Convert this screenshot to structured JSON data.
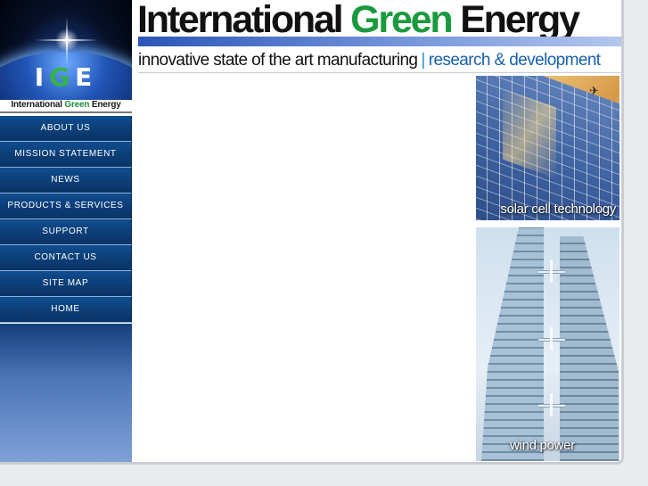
{
  "header": {
    "title_part1": "International",
    "title_green": "Green",
    "title_part3": "Energy",
    "tagline_left": "innovative state of the art manufacturing",
    "tagline_sep": "|",
    "tagline_right": "research & development"
  },
  "logo": {
    "letters": [
      "I",
      "G",
      "E"
    ],
    "caption_1": "International",
    "caption_green": "Green",
    "caption_3": "Energy"
  },
  "nav": {
    "items": [
      {
        "label": "ABOUT US"
      },
      {
        "label": "MISSION STATEMENT"
      },
      {
        "label": "NEWS"
      },
      {
        "label": "PRODUCTS & SERVICES"
      },
      {
        "label": "SUPPORT"
      },
      {
        "label": "CONTACT US"
      },
      {
        "label": "SITE MAP"
      },
      {
        "label": "HOME"
      }
    ]
  },
  "photos": {
    "solar_label": "solar cell technology",
    "wind_label": "wind power"
  },
  "colors": {
    "brand_green": "#1a9a3f",
    "nav_blue": "#0c3f78",
    "accent_blue": "#1761ad"
  }
}
